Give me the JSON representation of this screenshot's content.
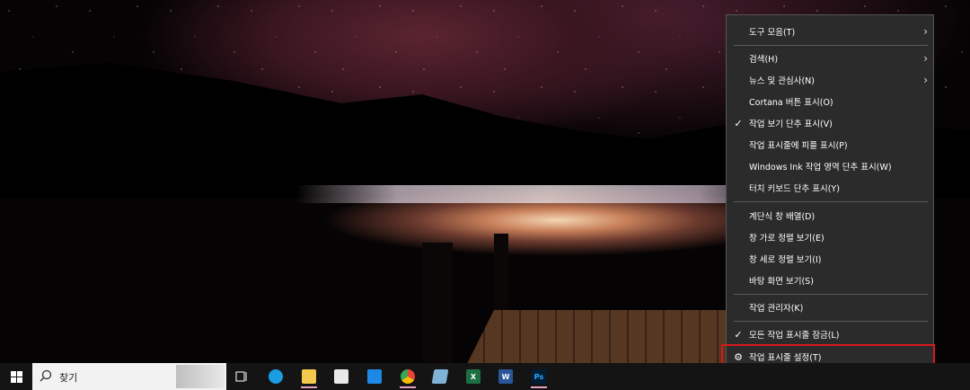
{
  "menu": {
    "items": [
      {
        "label": "도구 모음(T)",
        "submenu": true
      },
      {
        "label": "검색(H)",
        "submenu": true
      },
      {
        "label": "뉴스 및 관심사(N)",
        "submenu": true
      },
      {
        "label": "Cortana 버튼 표시(O)",
        "submenu": false
      },
      {
        "label": "작업 보기 단추 표시(V)",
        "checked": true
      },
      {
        "label": "작업 표시줄에 피플 표시(P)"
      },
      {
        "label": "Windows Ink 작업 영역 단추 표시(W)"
      },
      {
        "label": "터치 키보드 단추 표시(Y)"
      },
      {
        "label": "계단식 창 배열(D)"
      },
      {
        "label": "창 가로 정렬 보기(E)"
      },
      {
        "label": "창 세로 정렬 보기(I)"
      },
      {
        "label": "바탕 화면 보기(S)"
      },
      {
        "label": "작업 관리자(K)"
      },
      {
        "label": "모든 작업 표시줄 잠금(L)",
        "checked": true
      },
      {
        "label": "작업 표시줄 설정(T)",
        "icon": "gear-icon",
        "highlighted": true
      }
    ],
    "check_glyph": "✓",
    "arrow_glyph": "›"
  },
  "taskbar": {
    "search_placeholder": "찾기",
    "apps": [
      {
        "name": "task-view-icon"
      },
      {
        "name": "edge-icon",
        "color": "#1b9de2"
      },
      {
        "name": "file-explorer-icon",
        "color": "#f2c94c",
        "active": true
      },
      {
        "name": "store-icon",
        "color": "#e8e8e8"
      },
      {
        "name": "mail-icon",
        "color": "#1e88e5"
      },
      {
        "name": "chrome-icon",
        "color": "#ea4335",
        "active": true
      },
      {
        "name": "notes-icon",
        "color": "#7fb3d5"
      },
      {
        "name": "excel-icon",
        "color": "#1d6f42",
        "text": "X"
      },
      {
        "name": "word-icon",
        "color": "#2b579a",
        "text": "W"
      },
      {
        "name": "photoshop-icon",
        "color": "#001e36",
        "text": "Ps",
        "active": true
      }
    ]
  },
  "colors": {
    "menu_bg": "#2b2b2b",
    "highlight_border": "#d6191f",
    "taskbar_bg": "#141414"
  }
}
